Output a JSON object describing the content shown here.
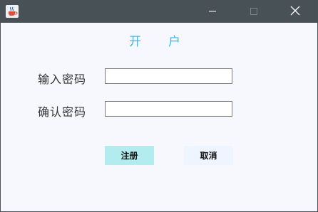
{
  "window": {
    "icon": "java-cup-icon",
    "controls": {
      "minimize": "minimize-icon",
      "maximize": "maximize-icon",
      "close": "close-icon"
    },
    "colors": {
      "titlebar": "#485156",
      "body": "#f7f8fe"
    }
  },
  "form": {
    "heading_left": "开",
    "heading_right": "户",
    "heading_color": "#3ab8e6",
    "password_label": "输入密码",
    "password_value": "",
    "confirm_label": "确认密码",
    "confirm_value": ""
  },
  "buttons": {
    "register_label": "注册",
    "register_color": "#b2ecee",
    "cancel_label": "取消",
    "cancel_color": "#eef5ff"
  }
}
